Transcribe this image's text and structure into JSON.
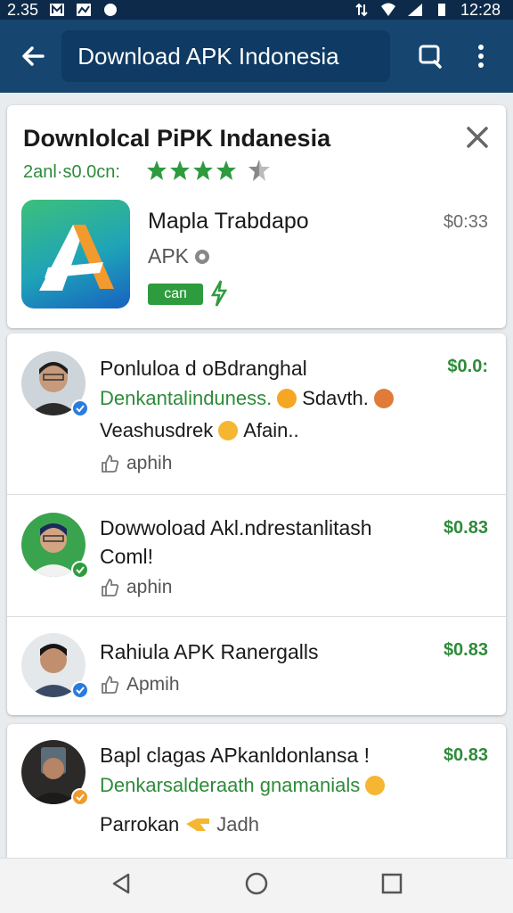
{
  "status_bar": {
    "time": "12:28",
    "left_text": "2.35"
  },
  "appbar": {
    "search_text": "Download APK Indonesia"
  },
  "header": {
    "title": "Downlolcal PiPK Indanesia",
    "rating_text": "2anl·s0.0cn:",
    "stars": 4,
    "app_name": "Mapla Trabdaрo",
    "app_type": "APK",
    "price": "$0:33",
    "badge": "caп"
  },
  "results": [
    {
      "title": "Ponluloa d oBdranghal",
      "line2": "Denkantalinduness.",
      "line2_extra": "Sdavth.",
      "line3": "Veashusdrek",
      "line3_extra": "Afain..",
      "author": "aphih",
      "price": "$0.0:"
    },
    {
      "title": "Dowwoload Akl.ndrestanlitash",
      "title2": "Coml!",
      "author": "aphin",
      "price": "$0.83"
    },
    {
      "title": "Rahiula APK Ranergalls",
      "author": "Apmih",
      "price": "$0.83"
    },
    {
      "title": "Bapl clagas APkanldonlansa !",
      "line2": "Denkarsalderaath gnamanials",
      "line3": "Parrokan",
      "line3_extra": "Jadh",
      "price": "$0.83"
    }
  ],
  "colors": {
    "appbar": "#16466f",
    "accent_green": "#2e8b3a",
    "status_bar": "#0d2a4a"
  }
}
